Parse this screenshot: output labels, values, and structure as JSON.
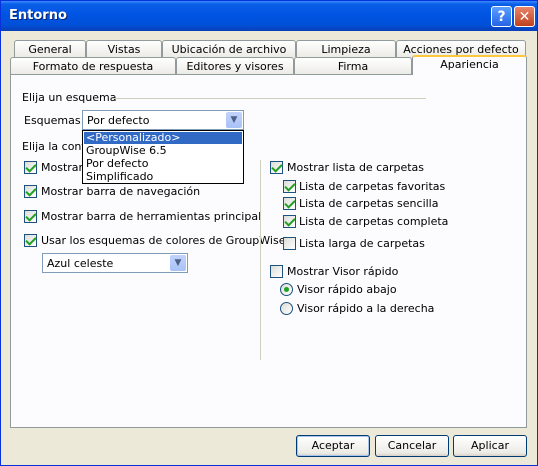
{
  "window": {
    "title": "Entorno"
  },
  "tabs_row_back": [
    "General",
    "Vistas",
    "Ubicación de archivo",
    "Limpieza",
    "Acciones por defecto"
  ],
  "tabs_row_front": [
    "Formato de respuesta",
    "Editores y visores",
    "Firma",
    "Apariencia"
  ],
  "scheme": {
    "group_label": "Elija un esquema",
    "schemes_label": "Esquemas:",
    "value": "Por defecto",
    "options": [
      "<Personalizado>",
      "GroupWise 6.5",
      "Por defecto",
      "Simplificado"
    ]
  },
  "config": {
    "group_label": "Elija la configu",
    "show_prefix": "Mostrar n",
    "nav_bar": "Mostrar barra de navegación",
    "toolbar": "Mostrar barra de herramientas principal",
    "colors": "Usar los esquemas de colores de GroupWise",
    "color_value": "Azul celeste"
  },
  "folders": {
    "show_list": "Mostrar lista de carpetas",
    "favorites": "Lista de carpetas favoritas",
    "simple": "Lista de carpetas sencilla",
    "complete": "Lista de carpetas completa",
    "long": "Lista larga de carpetas"
  },
  "viewer": {
    "show": "Mostrar Visor rápido",
    "below": "Visor rápido abajo",
    "right": "Visor rápido a la derecha"
  },
  "buttons": {
    "ok": "Aceptar",
    "cancel": "Cancelar",
    "apply": "Aplicar"
  }
}
